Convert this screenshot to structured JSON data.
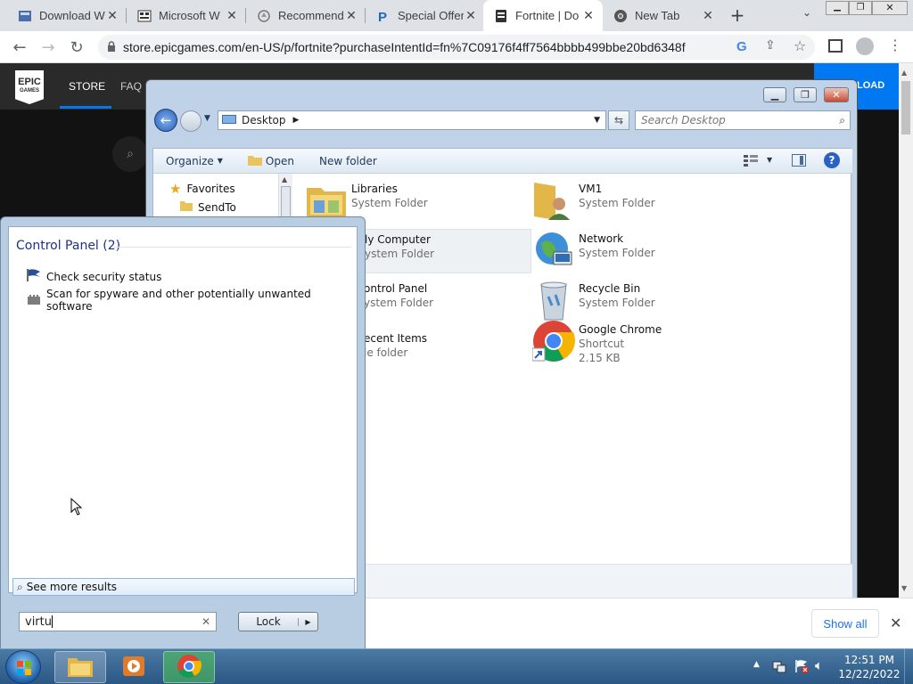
{
  "browser": {
    "tabs": [
      {
        "title": "Download W",
        "icon": "download-page-icon"
      },
      {
        "title": "Microsoft W",
        "icon": "microsoft-page-icon"
      },
      {
        "title": "Recommend",
        "icon": "recommend-page-icon"
      },
      {
        "title": "Special Offer",
        "icon": "paypal-icon"
      },
      {
        "title": "Fortnite | Do",
        "icon": "epic-page-icon"
      },
      {
        "title": "New Tab",
        "icon": "chrome-icon"
      }
    ],
    "url": "store.epicgames.com/en-US/p/fortnite?purchaseIntentId=fn%7C09176f4ff7564bbbb499bbe20bd6348f"
  },
  "epic": {
    "logo_top": "EPIC",
    "logo_bottom": "GAMES",
    "nav": [
      "STORE",
      "FAQ"
    ],
    "download_label": "LOAD"
  },
  "explorer": {
    "address": "Desktop",
    "search_placeholder": "Search Desktop",
    "toolbar": {
      "organize": "Organize",
      "open": "Open",
      "new_folder": "New folder"
    },
    "nav": {
      "favorites": "Favorites",
      "sendto": "SendTo"
    },
    "items": [
      {
        "name": "Libraries",
        "type": "System Folder"
      },
      {
        "name": "VM1",
        "type": "System Folder"
      },
      {
        "name": "ly Computer",
        "type": "ystem Folder"
      },
      {
        "name": "Network",
        "type": "System Folder"
      },
      {
        "name": "ontrol Panel",
        "type": "ystem Folder"
      },
      {
        "name": "Recycle Bin",
        "type": "System Folder"
      },
      {
        "name": "ecent Items",
        "type": "le folder"
      },
      {
        "name": "Google Chrome",
        "type": "Shortcut",
        "size": "2.15 KB"
      }
    ]
  },
  "startmenu": {
    "group_title": "Control Panel (2)",
    "results": [
      "Check security status",
      "Scan for spyware and other potentially unwanted software"
    ],
    "see_more": "See more results",
    "search_value": "virtu",
    "lock_label": "Lock"
  },
  "downloads": {
    "show_all": "Show all"
  },
  "taskbar": {
    "time": "12:51 PM",
    "date": "12/22/2022"
  },
  "colors": {
    "epic_blue": "#0078f2",
    "taskbar": "#2a5784"
  }
}
